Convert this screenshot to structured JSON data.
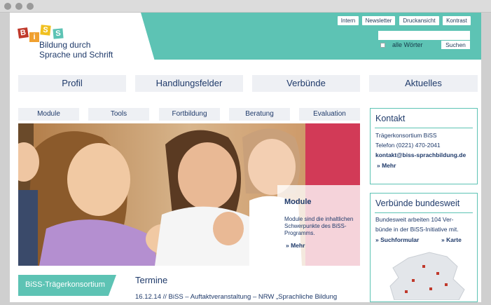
{
  "meta_nav": [
    "Intern",
    "Newsletter",
    "Druckansicht",
    "Kontrast"
  ],
  "logo": {
    "letters": [
      "B",
      "i",
      "S",
      "S"
    ],
    "line1": "Bildung durch",
    "line2": "Sprache und Schrift",
    "colors": [
      "#d9534f",
      "#f0a030",
      "#5dc3b4",
      "#5dc3b4"
    ]
  },
  "search": {
    "value": "",
    "checkbox_label": "alle Wörter",
    "button_label": "Suchen"
  },
  "main_nav": [
    "Profil",
    "Handlungsfelder",
    "Verbünde",
    "Aktuelles"
  ],
  "sub_nav": [
    "Module",
    "Tools",
    "Fortbildung",
    "Beratung",
    "Evaluation"
  ],
  "hero": {
    "title": "Module",
    "text": "Module sind die inhaltlichen Schwerpunkte des BiSS-Programms.",
    "more": "» Mehr"
  },
  "kontakt": {
    "title": "Kontakt",
    "line1": "Trägerkonsortium BiSS",
    "line2": "Telefon (0221) 470-2041",
    "email": "kontakt@biss-sprachbildung.de",
    "more": "» Mehr"
  },
  "verbuende": {
    "title": "Verbünde bundesweit",
    "text1": "Bundesweit arbeiten 104 Ver-",
    "text2": "bünde in der BiSS-Initiative mit.",
    "link1": "» Suchformular",
    "link2": "» Karte"
  },
  "traeger": {
    "label": "BiSS-Trägerkonsortium"
  },
  "termine": {
    "title": "Termine",
    "entry": "16.12.14 // BiSS – Auftaktveranstaltung – NRW „Sprachliche Bildung"
  },
  "colors": {
    "accent": "#5dc3b4",
    "text": "#1f3a6a",
    "nav_bg": "#eef0f4"
  }
}
